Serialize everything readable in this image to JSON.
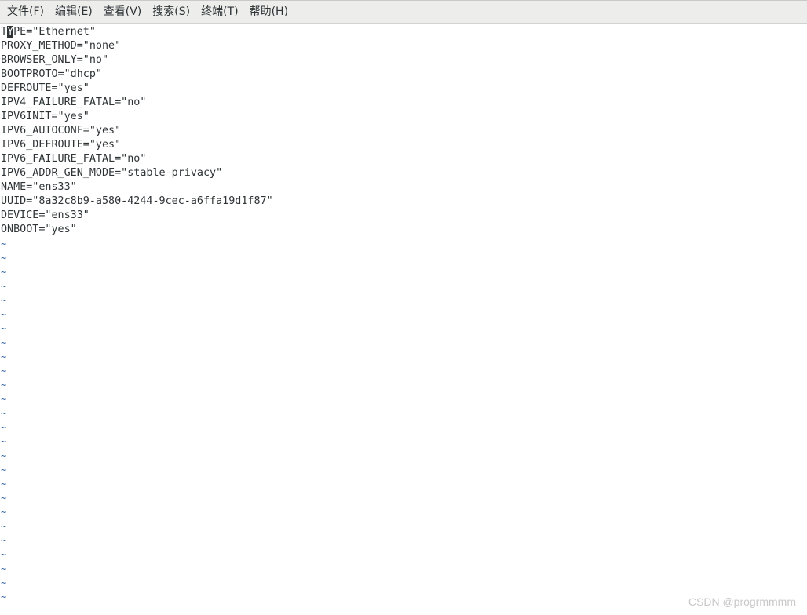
{
  "menubar": {
    "items": [
      {
        "label": "文件(F)"
      },
      {
        "label": "编辑(E)"
      },
      {
        "label": "查看(V)"
      },
      {
        "label": "搜索(S)"
      },
      {
        "label": "终端(T)"
      },
      {
        "label": "帮助(H)"
      }
    ]
  },
  "terminal": {
    "first_line": {
      "before_cursor": "T",
      "cursor_char": "Y",
      "after_cursor": "PE=\"Ethernet\""
    },
    "lines": [
      "PROXY_METHOD=\"none\"",
      "BROWSER_ONLY=\"no\"",
      "BOOTPROTO=\"dhcp\"",
      "DEFROUTE=\"yes\"",
      "IPV4_FAILURE_FATAL=\"no\"",
      "IPV6INIT=\"yes\"",
      "IPV6_AUTOCONF=\"yes\"",
      "IPV6_DEFROUTE=\"yes\"",
      "IPV6_FAILURE_FATAL=\"no\"",
      "IPV6_ADDR_GEN_MODE=\"stable-privacy\"",
      "NAME=\"ens33\"",
      "UUID=\"8a32c8b9-a580-4244-9cec-a6ffa19d1f87\"",
      "DEVICE=\"ens33\"",
      "ONBOOT=\"yes\""
    ],
    "empty_line_marker": "~",
    "empty_lines_count": 26
  },
  "watermark": {
    "text": "CSDN @progrmmmm"
  },
  "colors": {
    "menubar_bg": "#ededec",
    "text": "#2e3436",
    "tilde": "#3465a4",
    "watermark": "#c8c8c8"
  }
}
